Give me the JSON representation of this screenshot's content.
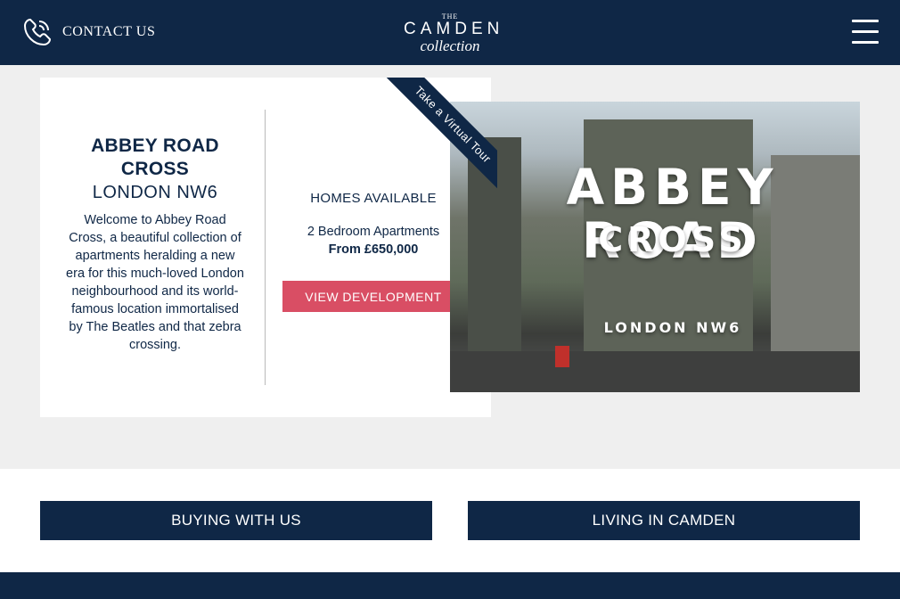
{
  "header": {
    "contact_label": "CONTACT US",
    "logo": {
      "the": "THE",
      "main": "CAMDEN",
      "sub": "collection"
    }
  },
  "development": {
    "name": "ABBEY ROAD CROSS",
    "location": "LONDON NW6",
    "description": "Welcome to Abbey Road Cross, a beautiful collection of apartments heralding a new era for this much-loved London neighbourhood and its world-famous location immortalised by The Beatles and that zebra crossing.",
    "homes_heading": "HOMES AVAILABLE",
    "apartment_type": "2 Bedroom Apartments",
    "price": "From £650,000",
    "cta_label": "VIEW DEVELOPMENT",
    "virtual_tour_label": "Take a Virtual Tour",
    "image": {
      "title": "ABBEY ROAD",
      "subtitle": "CROSS",
      "location": "LONDON NW6"
    }
  },
  "links": {
    "buying_label": "BUYING WITH US",
    "living_label": "LIVING IN CAMDEN"
  },
  "colors": {
    "navy": "#0f2746",
    "accent_pink": "#d94e64",
    "page_bg": "#efefef"
  }
}
